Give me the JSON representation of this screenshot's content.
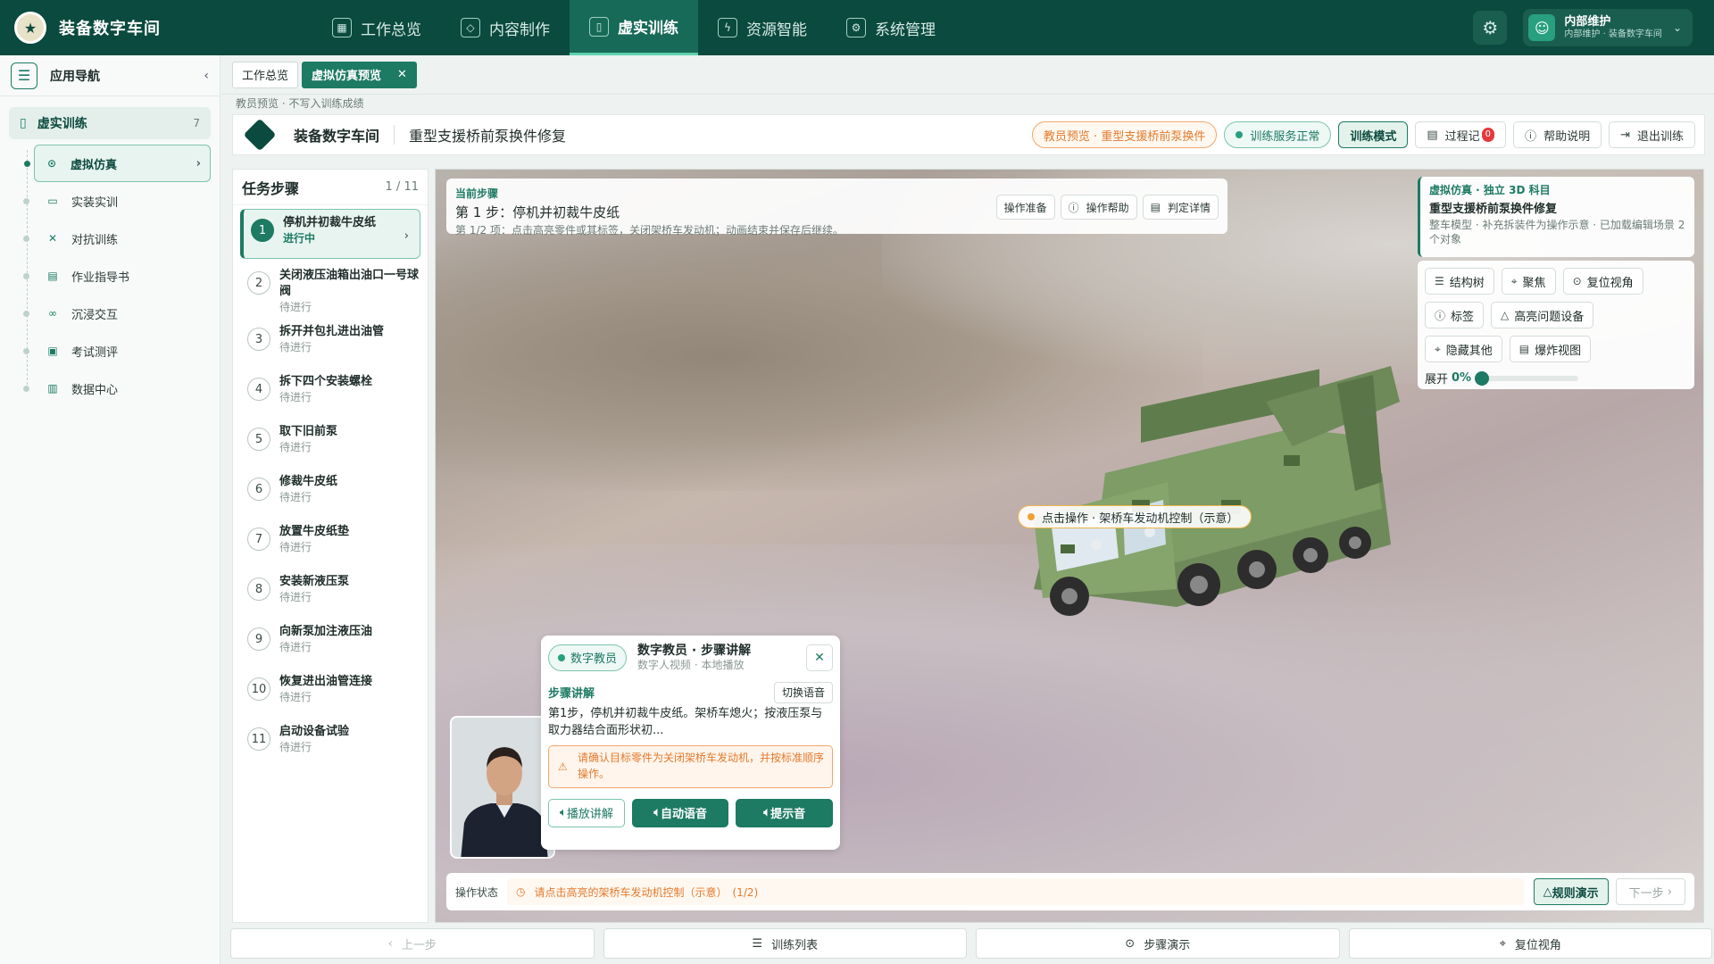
{
  "app": {
    "title": "装备数字车间",
    "logo_icon": "emblem-icon"
  },
  "nav": [
    {
      "label": "工作总览",
      "icon": "grid-icon",
      "active": false
    },
    {
      "label": "内容制作",
      "icon": "cube-icon",
      "active": false
    },
    {
      "label": "虚实训练",
      "icon": "book-icon",
      "active": true
    },
    {
      "label": "资源智能",
      "icon": "ai-icon",
      "active": false
    },
    {
      "label": "系统管理",
      "icon": "gear-icon",
      "active": false
    }
  ],
  "user": {
    "name": "内部维护",
    "sub": "内部维护 · 装备数字车间"
  },
  "sidebar": {
    "title": "应用导航",
    "group": {
      "label": "虚实训练",
      "count": "7"
    },
    "items": [
      {
        "label": "虚拟仿真",
        "icon": "play-circle-icon"
      },
      {
        "label": "实装实训",
        "icon": "monitor-icon"
      },
      {
        "label": "对抗训练",
        "icon": "sword-icon"
      },
      {
        "label": "作业指导书",
        "icon": "doc-icon"
      },
      {
        "label": "沉浸交互",
        "icon": "vr-icon"
      },
      {
        "label": "考试测评",
        "icon": "clipboard-icon"
      },
      {
        "label": "数据中心",
        "icon": "chart-icon"
      }
    ]
  },
  "tabs": [
    {
      "label": "工作总览"
    },
    {
      "label": "虚拟仿真预览",
      "closable": true
    }
  ],
  "hint": "教员预览 · 不写入训练成绩",
  "header": {
    "name": "装备数字车间",
    "subtitle": "重型支援桥前泵换件修复",
    "preview_pill": "教员预览 · 重型支援桥前泵换件",
    "service_pill": "训练服务正常",
    "mode_pill": "训练模式",
    "record_btn": "过程记",
    "record_badge": "0",
    "help_btn": "帮助说明",
    "exit_btn": "退出训练"
  },
  "steps": {
    "title": "任务步骤",
    "count": "1 / 11",
    "items": [
      {
        "num": "1",
        "name": "停机并初裁牛皮纸",
        "status": "进行中"
      },
      {
        "num": "2",
        "name": "关闭液压油箱出油口一号球阀",
        "status": "待进行"
      },
      {
        "num": "3",
        "name": "拆开并包扎进出油管",
        "status": "待进行"
      },
      {
        "num": "4",
        "name": "拆下四个安装螺栓",
        "status": "待进行"
      },
      {
        "num": "5",
        "name": "取下旧前泵",
        "status": "待进行"
      },
      {
        "num": "6",
        "name": "修裁牛皮纸",
        "status": "待进行"
      },
      {
        "num": "7",
        "name": "放置牛皮纸垫",
        "status": "待进行"
      },
      {
        "num": "8",
        "name": "安装新液压泵",
        "status": "待进行"
      },
      {
        "num": "9",
        "name": "向新泵加注液压油",
        "status": "待进行"
      },
      {
        "num": "10",
        "name": "恢复进出油管连接",
        "status": "待进行"
      },
      {
        "num": "11",
        "name": "启动设备试验",
        "status": "待进行"
      }
    ]
  },
  "current_step": {
    "label": "当前步骤",
    "title": "第 1 步：停机并初裁牛皮纸",
    "desc": "第 1/2 项：点击高亮零件或其标签，关闭架桥车发动机；动画结束并保存后继续。",
    "btn_prepare": "操作准备",
    "btn_help": "操作帮助",
    "btn_judge": "判定详情"
  },
  "sim_card": {
    "line1": "虚拟仿真 · 独立 3D 科目",
    "line2": "重型支援桥前泵换件修复",
    "line3": "整车模型 · 补充拆装件为操作示意 · 已加载编辑场景 2 个对象"
  },
  "tools": {
    "structure": "结构树",
    "focus": "聚焦",
    "reset_view": "复位视角",
    "label": "标签",
    "highlight": "高亮问题设备",
    "hide_others": "隐藏其他",
    "explode": "爆炸视图",
    "expand_label": "展开",
    "expand_value": "0%",
    "expand_level": 0
  },
  "callout": "点击操作 · 架桥车发动机控制（示意）",
  "teacher": {
    "badge": "数字教员",
    "title": "数字教员 · 步骤讲解",
    "sub": "数字人视频 · 本地播放",
    "section": "步骤讲解",
    "switch_voice": "切换语音",
    "text": "第1步，停机并初裁牛皮纸。架桥车熄火；按液压泵与取力器结合面形状初...",
    "warning": "请确认目标零件为关闭架桥车发动机，并按标准顺序操作。",
    "btn_play": "播放讲解",
    "btn_auto": "自动语音",
    "btn_tone": "提示音"
  },
  "status": {
    "label": "操作状态",
    "message": "请点击高亮的架桥车发动机控制（示意）　(1/2)",
    "demo_btn": "规则演示",
    "next_btn": "下一步"
  },
  "footer": {
    "prev": "上一步",
    "list": "训练列表",
    "demo": "步骤演示",
    "reset": "复位视角"
  }
}
